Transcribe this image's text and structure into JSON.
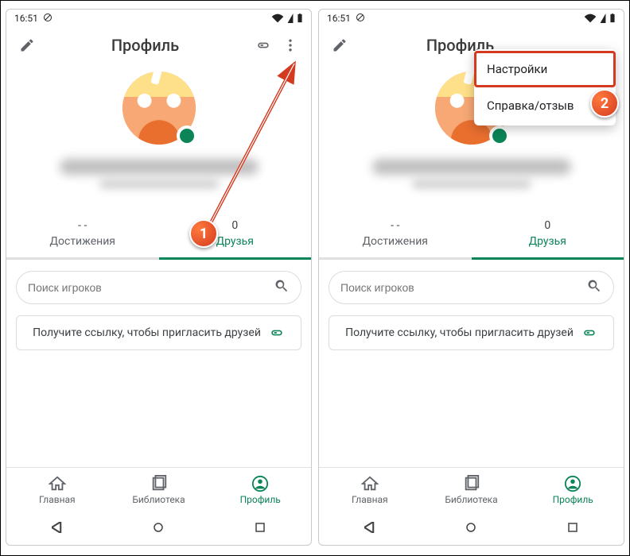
{
  "status": {
    "time": "16:51"
  },
  "appbar": {
    "title": "Профиль"
  },
  "tabs": {
    "achievements": {
      "value": "- -",
      "label": "Достижения"
    },
    "friends": {
      "value": "0",
      "label": "Друзья"
    }
  },
  "search": {
    "placeholder": "Поиск игроков"
  },
  "invite": {
    "label": "Получите ссылку, чтобы пригласить друзей"
  },
  "bottomnav": {
    "home": "Главная",
    "library": "Библиотека",
    "profile": "Профиль"
  },
  "menu": {
    "settings": "Настройки",
    "help": "Справка/отзыв"
  },
  "callouts": {
    "one": "1",
    "two": "2"
  }
}
